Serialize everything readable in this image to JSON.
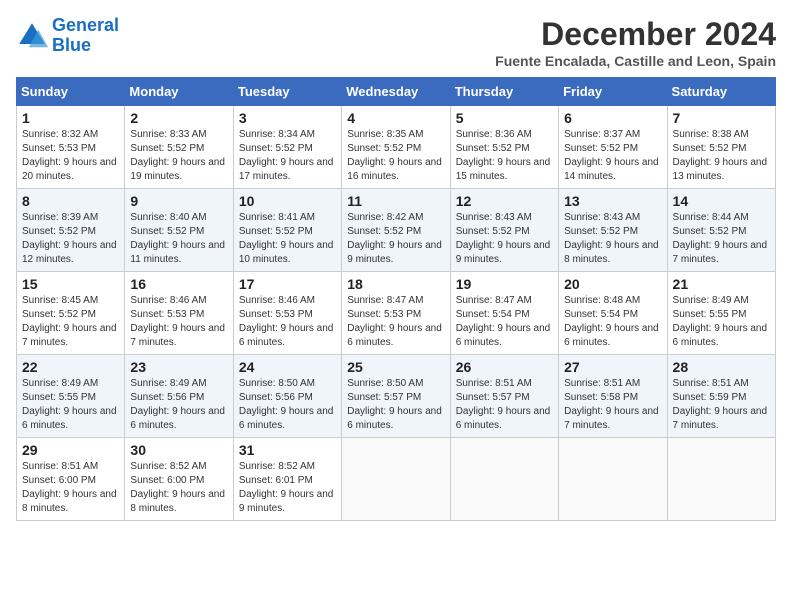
{
  "header": {
    "logo_line1": "General",
    "logo_line2": "Blue",
    "month_title": "December 2024",
    "subtitle": "Fuente Encalada, Castille and Leon, Spain"
  },
  "weekdays": [
    "Sunday",
    "Monday",
    "Tuesday",
    "Wednesday",
    "Thursday",
    "Friday",
    "Saturday"
  ],
  "weeks": [
    [
      {
        "day": "1",
        "sunrise": "Sunrise: 8:32 AM",
        "sunset": "Sunset: 5:53 PM",
        "daylight": "Daylight: 9 hours and 20 minutes."
      },
      {
        "day": "2",
        "sunrise": "Sunrise: 8:33 AM",
        "sunset": "Sunset: 5:52 PM",
        "daylight": "Daylight: 9 hours and 19 minutes."
      },
      {
        "day": "3",
        "sunrise": "Sunrise: 8:34 AM",
        "sunset": "Sunset: 5:52 PM",
        "daylight": "Daylight: 9 hours and 17 minutes."
      },
      {
        "day": "4",
        "sunrise": "Sunrise: 8:35 AM",
        "sunset": "Sunset: 5:52 PM",
        "daylight": "Daylight: 9 hours and 16 minutes."
      },
      {
        "day": "5",
        "sunrise": "Sunrise: 8:36 AM",
        "sunset": "Sunset: 5:52 PM",
        "daylight": "Daylight: 9 hours and 15 minutes."
      },
      {
        "day": "6",
        "sunrise": "Sunrise: 8:37 AM",
        "sunset": "Sunset: 5:52 PM",
        "daylight": "Daylight: 9 hours and 14 minutes."
      },
      {
        "day": "7",
        "sunrise": "Sunrise: 8:38 AM",
        "sunset": "Sunset: 5:52 PM",
        "daylight": "Daylight: 9 hours and 13 minutes."
      }
    ],
    [
      {
        "day": "8",
        "sunrise": "Sunrise: 8:39 AM",
        "sunset": "Sunset: 5:52 PM",
        "daylight": "Daylight: 9 hours and 12 minutes."
      },
      {
        "day": "9",
        "sunrise": "Sunrise: 8:40 AM",
        "sunset": "Sunset: 5:52 PM",
        "daylight": "Daylight: 9 hours and 11 minutes."
      },
      {
        "day": "10",
        "sunrise": "Sunrise: 8:41 AM",
        "sunset": "Sunset: 5:52 PM",
        "daylight": "Daylight: 9 hours and 10 minutes."
      },
      {
        "day": "11",
        "sunrise": "Sunrise: 8:42 AM",
        "sunset": "Sunset: 5:52 PM",
        "daylight": "Daylight: 9 hours and 9 minutes."
      },
      {
        "day": "12",
        "sunrise": "Sunrise: 8:43 AM",
        "sunset": "Sunset: 5:52 PM",
        "daylight": "Daylight: 9 hours and 9 minutes."
      },
      {
        "day": "13",
        "sunrise": "Sunrise: 8:43 AM",
        "sunset": "Sunset: 5:52 PM",
        "daylight": "Daylight: 9 hours and 8 minutes."
      },
      {
        "day": "14",
        "sunrise": "Sunrise: 8:44 AM",
        "sunset": "Sunset: 5:52 PM",
        "daylight": "Daylight: 9 hours and 7 minutes."
      }
    ],
    [
      {
        "day": "15",
        "sunrise": "Sunrise: 8:45 AM",
        "sunset": "Sunset: 5:52 PM",
        "daylight": "Daylight: 9 hours and 7 minutes."
      },
      {
        "day": "16",
        "sunrise": "Sunrise: 8:46 AM",
        "sunset": "Sunset: 5:53 PM",
        "daylight": "Daylight: 9 hours and 7 minutes."
      },
      {
        "day": "17",
        "sunrise": "Sunrise: 8:46 AM",
        "sunset": "Sunset: 5:53 PM",
        "daylight": "Daylight: 9 hours and 6 minutes."
      },
      {
        "day": "18",
        "sunrise": "Sunrise: 8:47 AM",
        "sunset": "Sunset: 5:53 PM",
        "daylight": "Daylight: 9 hours and 6 minutes."
      },
      {
        "day": "19",
        "sunrise": "Sunrise: 8:47 AM",
        "sunset": "Sunset: 5:54 PM",
        "daylight": "Daylight: 9 hours and 6 minutes."
      },
      {
        "day": "20",
        "sunrise": "Sunrise: 8:48 AM",
        "sunset": "Sunset: 5:54 PM",
        "daylight": "Daylight: 9 hours and 6 minutes."
      },
      {
        "day": "21",
        "sunrise": "Sunrise: 8:49 AM",
        "sunset": "Sunset: 5:55 PM",
        "daylight": "Daylight: 9 hours and 6 minutes."
      }
    ],
    [
      {
        "day": "22",
        "sunrise": "Sunrise: 8:49 AM",
        "sunset": "Sunset: 5:55 PM",
        "daylight": "Daylight: 9 hours and 6 minutes."
      },
      {
        "day": "23",
        "sunrise": "Sunrise: 8:49 AM",
        "sunset": "Sunset: 5:56 PM",
        "daylight": "Daylight: 9 hours and 6 minutes."
      },
      {
        "day": "24",
        "sunrise": "Sunrise: 8:50 AM",
        "sunset": "Sunset: 5:56 PM",
        "daylight": "Daylight: 9 hours and 6 minutes."
      },
      {
        "day": "25",
        "sunrise": "Sunrise: 8:50 AM",
        "sunset": "Sunset: 5:57 PM",
        "daylight": "Daylight: 9 hours and 6 minutes."
      },
      {
        "day": "26",
        "sunrise": "Sunrise: 8:51 AM",
        "sunset": "Sunset: 5:57 PM",
        "daylight": "Daylight: 9 hours and 6 minutes."
      },
      {
        "day": "27",
        "sunrise": "Sunrise: 8:51 AM",
        "sunset": "Sunset: 5:58 PM",
        "daylight": "Daylight: 9 hours and 7 minutes."
      },
      {
        "day": "28",
        "sunrise": "Sunrise: 8:51 AM",
        "sunset": "Sunset: 5:59 PM",
        "daylight": "Daylight: 9 hours and 7 minutes."
      }
    ],
    [
      {
        "day": "29",
        "sunrise": "Sunrise: 8:51 AM",
        "sunset": "Sunset: 6:00 PM",
        "daylight": "Daylight: 9 hours and 8 minutes."
      },
      {
        "day": "30",
        "sunrise": "Sunrise: 8:52 AM",
        "sunset": "Sunset: 6:00 PM",
        "daylight": "Daylight: 9 hours and 8 minutes."
      },
      {
        "day": "31",
        "sunrise": "Sunrise: 8:52 AM",
        "sunset": "Sunset: 6:01 PM",
        "daylight": "Daylight: 9 hours and 9 minutes."
      },
      null,
      null,
      null,
      null
    ]
  ]
}
